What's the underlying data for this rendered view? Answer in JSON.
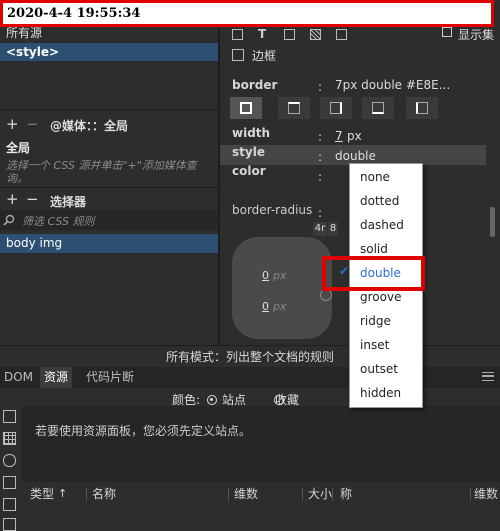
{
  "timestamp": "2020-4-4 19:55:34",
  "left_panel": {
    "sources_label": "所有源",
    "source_item": "<style>",
    "media": {
      "label": "@媒体：：全局",
      "global": "全局",
      "hint": "选择一个 CSS 源并单击\"+\"添加媒体查询。"
    },
    "selectors": {
      "label": "选择器",
      "filter_placeholder": "筛选 CSS 规则",
      "item": "body img"
    }
  },
  "right_panel": {
    "show_set_label": "显示集",
    "section": "边框",
    "border": {
      "label": "border",
      "colon": ":",
      "value": "7px double #E8E..."
    },
    "width": {
      "label": "width",
      "colon": ":",
      "num": "7",
      "unit": "px"
    },
    "style": {
      "label": "style",
      "colon": ":",
      "value": "double"
    },
    "color": {
      "label": "color",
      "colon": ":"
    },
    "radius": {
      "label": "border-radius",
      "colon": ":",
      "v1": "0",
      "unit1": "px",
      "v2": "0",
      "unit2": "px",
      "chip1": "4r",
      "chip2": "8"
    }
  },
  "dropdown": {
    "options": [
      "none",
      "dotted",
      "dashed",
      "solid",
      "double",
      "groove",
      "ridge",
      "inset",
      "outset",
      "hidden"
    ],
    "selected": "double",
    "check": "✔"
  },
  "status_bar": "所有模式：列出整个文档的规则",
  "bottom_tabs": [
    "DOM",
    "资源",
    "代码片断"
  ],
  "assets": {
    "color_label": "颜色:",
    "site_label": "站点",
    "favorites_label": "收藏",
    "message": "若要使用资源面板，您必须先定义站点。",
    "columns": [
      "类型",
      "名称",
      "维数",
      "大小",
      "称",
      "维数"
    ],
    "sort_arrow": "↑"
  },
  "colors": {
    "accent": "#2a6fd6",
    "highlight": "#e00000",
    "selection": "#2d4f72"
  }
}
